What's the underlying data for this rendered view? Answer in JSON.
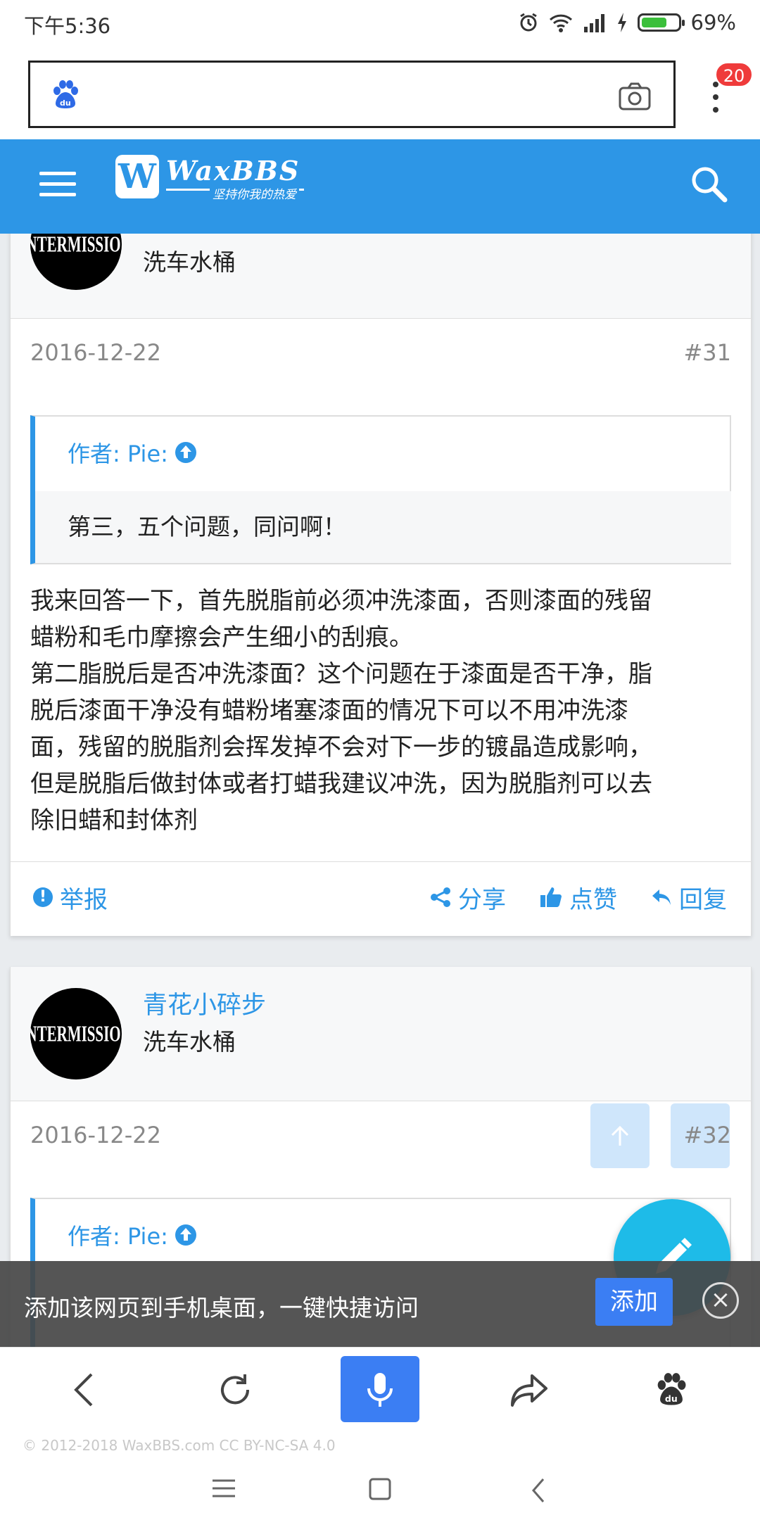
{
  "status_bar": {
    "time": "下午5:36",
    "battery_percent": "69%",
    "battery_level": 0.69
  },
  "browser": {
    "notification_count": "20"
  },
  "site": {
    "logo_letter": "W",
    "logo_title": "WaxBBS",
    "logo_slogan": "坚持你我的热爱"
  },
  "posts": [
    {
      "user_role": "洗车水桶",
      "avatar_text": "INTERMISSION",
      "date": "2016-12-22",
      "floor": "#31",
      "quote_author": "作者: Pie:",
      "quote_text": "第三，五个问题，同问啊！",
      "body_lines": [
        "我来回答一下，首先脱脂前必须冲洗漆面，否则漆面的残留",
        "蜡粉和毛巾摩擦会产生细小的刮痕。",
        "第二脂脱后是否冲洗漆面？这个问题在于漆面是否干净，脂",
        "脱后漆面干净没有蜡粉堵塞漆面的情况下可以不用冲洗漆",
        "面，残留的脱脂剂会挥发掉不会对下一步的镀晶造成影响，",
        "但是脱脂后做封体或者打蜡我建议冲洗，因为脱脂剂可以去",
        "除旧蜡和封体剂"
      ],
      "actions": {
        "report": "举报",
        "share": "分享",
        "like": "点赞",
        "reply": "回复"
      }
    },
    {
      "user_name": "青花小碎步",
      "user_role": "洗车水桶",
      "avatar_text": "INTERMISSION",
      "date": "2016-12-22",
      "floor": "#32",
      "quote_author": "作者: Pie:"
    }
  ],
  "toast": {
    "text": "添加该网页到手机桌面，一键快捷访问",
    "button": "添加"
  },
  "footer": {
    "copyright": "© 2012-2018 WaxBBS.com CC BY-NC-SA 4.0"
  },
  "colors": {
    "brand_blue": "#2d96e6",
    "fab": "#1ebbe8",
    "mic": "#3b7ef3"
  }
}
